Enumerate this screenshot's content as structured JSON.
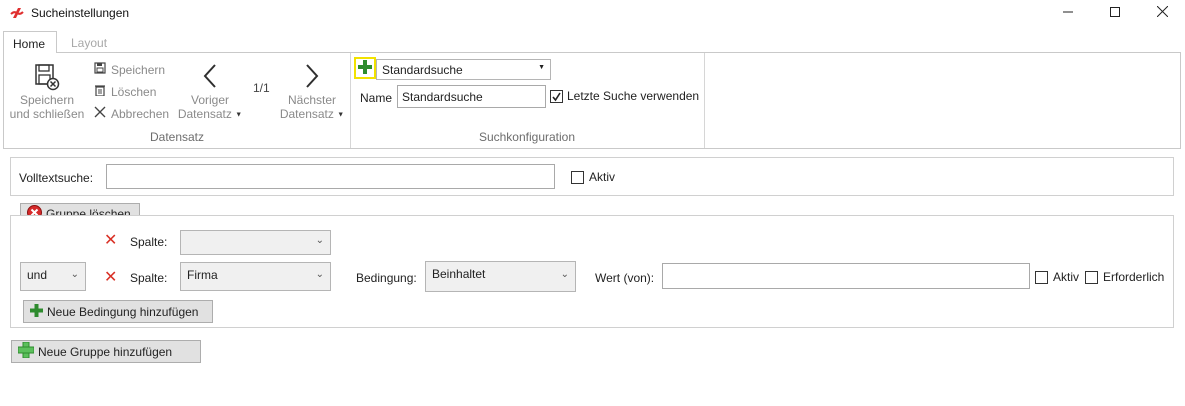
{
  "window": {
    "title": "Sucheinstellungen",
    "accent_color": "#e02f2f",
    "controls": [
      "minimize-icon",
      "maximize-icon",
      "close-icon"
    ]
  },
  "tabs": [
    {
      "label": "Home",
      "active": true
    },
    {
      "label": "Layout",
      "active": false
    }
  ],
  "ribbon": {
    "datensatz": {
      "save_close_line1": "Speichern",
      "save_close_line2": "und schließen",
      "save": "Speichern",
      "delete": "Löschen",
      "cancel": "Abbrechen",
      "prev_line1": "Voriger",
      "prev_line2": "Datensatz",
      "counter": "1/1",
      "next_line1": "Nächster",
      "next_line2": "Datensatz",
      "group_label": "Datensatz"
    },
    "suchkonfiguration": {
      "selected_search": "Standardsuche",
      "name_label": "Name",
      "name_value": "Standardsuche",
      "last_search_label": "Letzte Suche verwenden",
      "last_search_checked": true,
      "group_label": "Suchkonfiguration",
      "highlight_color": "#f2e200"
    }
  },
  "fulltext": {
    "label": "Volltextsuche:",
    "value": "",
    "active_label": "Aktiv",
    "active_checked": false
  },
  "group": {
    "delete_label": "Gruppe löschen",
    "rows": [
      {
        "logic": "",
        "column_label": "Spalte:",
        "column_value": ""
      },
      {
        "logic": "und",
        "column_label": "Spalte:",
        "column_value": "Firma",
        "condition_label": "Bedingung:",
        "condition_value": "Beinhaltet",
        "value_label": "Wert (von):",
        "value": "",
        "active_label": "Aktiv",
        "required_label": "Erforderlich"
      }
    ],
    "add_condition_label": "Neue Bedingung hinzufügen"
  },
  "add_group_label": "Neue Gruppe hinzufügen"
}
